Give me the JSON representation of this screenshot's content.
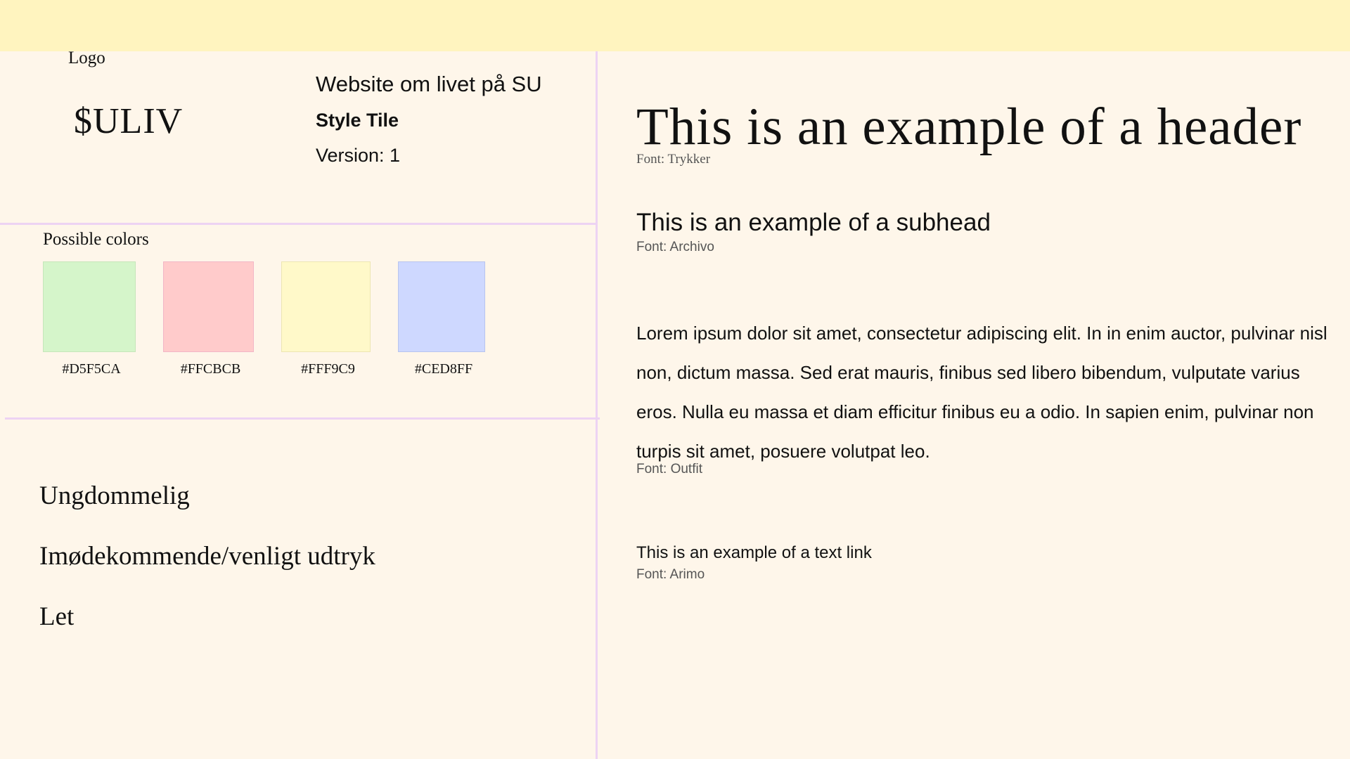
{
  "header_block": {
    "logo_label": "Logo",
    "logo_text": "$ULIV",
    "site_title": "Website om livet på SU",
    "doc_type": "Style Tile",
    "version": "Version: 1"
  },
  "colors": {
    "title": "Possible colors",
    "swatches": [
      {
        "hex": "#D5F5CA",
        "label": "#D5F5CA"
      },
      {
        "hex": "#FFCBCB",
        "label": "#FFCBCB"
      },
      {
        "hex": "#FFF9C9",
        "label": "#FFF9C9"
      },
      {
        "hex": "#CED8FF",
        "label": "#CED8FF"
      }
    ]
  },
  "keywords": [
    "Ungdommelig",
    "Imødekommende/venligt udtryk",
    "Let"
  ],
  "typography": {
    "header": {
      "text": "This is an example of a header",
      "font_note": "Font: Trykker"
    },
    "subhead": {
      "text": "This is an example of a subhead",
      "font_note": "Font: Archivo"
    },
    "body": {
      "text": "Lorem ipsum dolor sit amet, consectetur adipiscing elit. In in enim auctor, pulvinar nisl non, dictum massa. Sed erat mauris, finibus sed libero bibendum, vulputate varius eros. Nulla eu massa et diam efficitur finibus eu a odio. In sapien enim, pulvinar non turpis sit amet, posuere volutpat leo.",
      "font_note": "Font: Outfit"
    },
    "link": {
      "text": "This is an example of a text link",
      "font_note": "Font: Arimo"
    }
  },
  "theme": {
    "background": "#FEF6EA",
    "top_bar": "#FFF4BF",
    "divider": "#EDD3F3"
  }
}
